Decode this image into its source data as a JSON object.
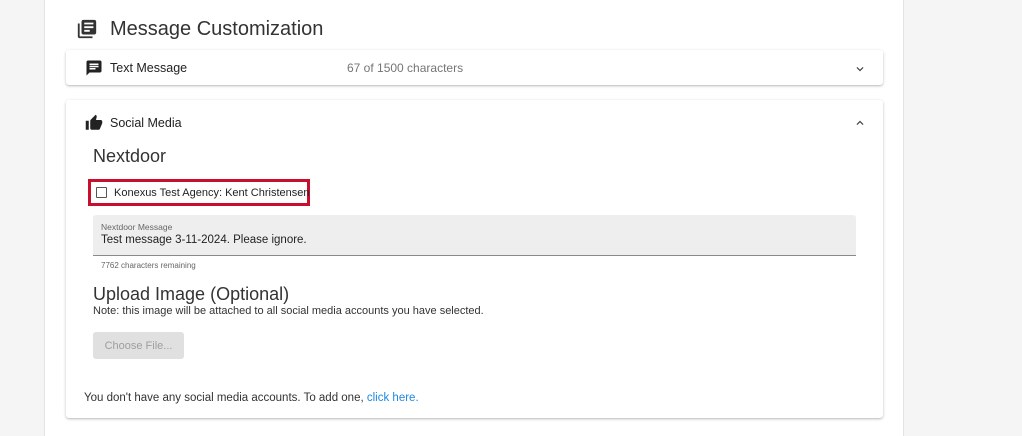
{
  "section": {
    "title": "Message Customization",
    "icon": "library-books-icon"
  },
  "text_message": {
    "label": "Text Message",
    "icon": "message-icon",
    "char_count": "67 of 1500 characters",
    "expanded": false
  },
  "social_media": {
    "label": "Social Media",
    "icon": "thumb-up-icon",
    "expanded": true,
    "nextdoor": {
      "title": "Nextdoor",
      "account_label": "Konexus Test Agency: Kent Christensen",
      "account_checked": false,
      "message_label": "Nextdoor Message",
      "message_value": "Test message 3-11-2024. Please ignore.",
      "remaining": "7762 characters remaining"
    },
    "upload": {
      "title": "Upload Image (Optional)",
      "note": "Note: this image will be attached to all social media accounts you have selected.",
      "button_label": "Choose File..."
    },
    "no_accounts_text": "You don't have any social media accounts. To add one, ",
    "no_accounts_link": "click here."
  },
  "colors": {
    "highlight_border": "#c8102e",
    "link": "#1e88e5"
  }
}
